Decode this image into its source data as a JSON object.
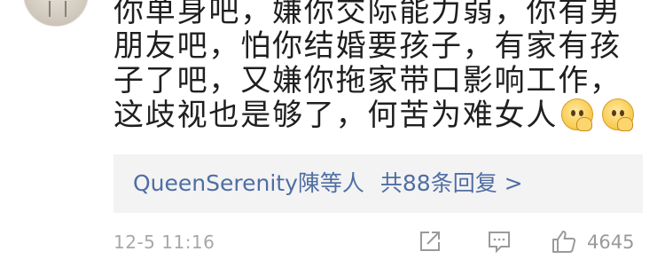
{
  "comment": {
    "text": "你单身吧，嫌你交际能力弱，你有男朋友吧，怕你结婚要孩子，有家有孩子了吧，又嫌你拖家带口影响工作，这歧视也是够了，何苦为难女人",
    "emojis": [
      "thinking-face-icon",
      "thinking-face-icon"
    ]
  },
  "replies": {
    "users": "QueenSerenity陳等人",
    "count_label": "共88条回复 >"
  },
  "footer": {
    "timestamp": "12-5 11:16",
    "like_count": "4645"
  },
  "colors": {
    "link": "#4f6ea3",
    "reply_bg": "#f3f3f4",
    "meta_gray": "#a8a8a8"
  }
}
